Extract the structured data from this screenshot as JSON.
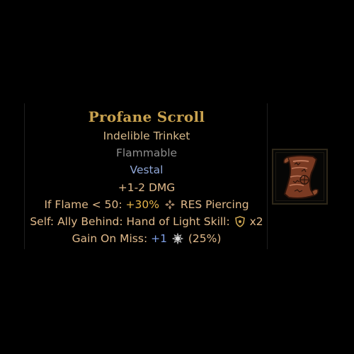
{
  "tooltip": {
    "title": "Profane Scroll",
    "type": "Indelible Trinket",
    "tag": "Flammable",
    "class": "Vestal",
    "stat_damage": "+1-2 DMG",
    "flame_condition": "If Flame < 50:",
    "flame_bonus": "+30%",
    "flame_stat": "RES Piercing",
    "self_ally": "Self: Ally Behind:",
    "skill_condition": "Hand of Light Skill:",
    "skill_multiplier": "x2",
    "gain_on_miss": "Gain On Miss:",
    "gain_amount": "+1",
    "gain_chance": "(25%)"
  },
  "icons": {
    "res_piercing": "res-piercing-icon",
    "shield_token": "shield-token-icon",
    "combo_token": "combo-token-icon",
    "item": "profane-scroll-icon"
  },
  "colors": {
    "title": "#c9a24f",
    "body": "#e0b98a",
    "tag": "#8d8d8d",
    "class": "#8fa6d6",
    "highlight": "#e6b44a",
    "token_blue": "#7f9fe6"
  }
}
